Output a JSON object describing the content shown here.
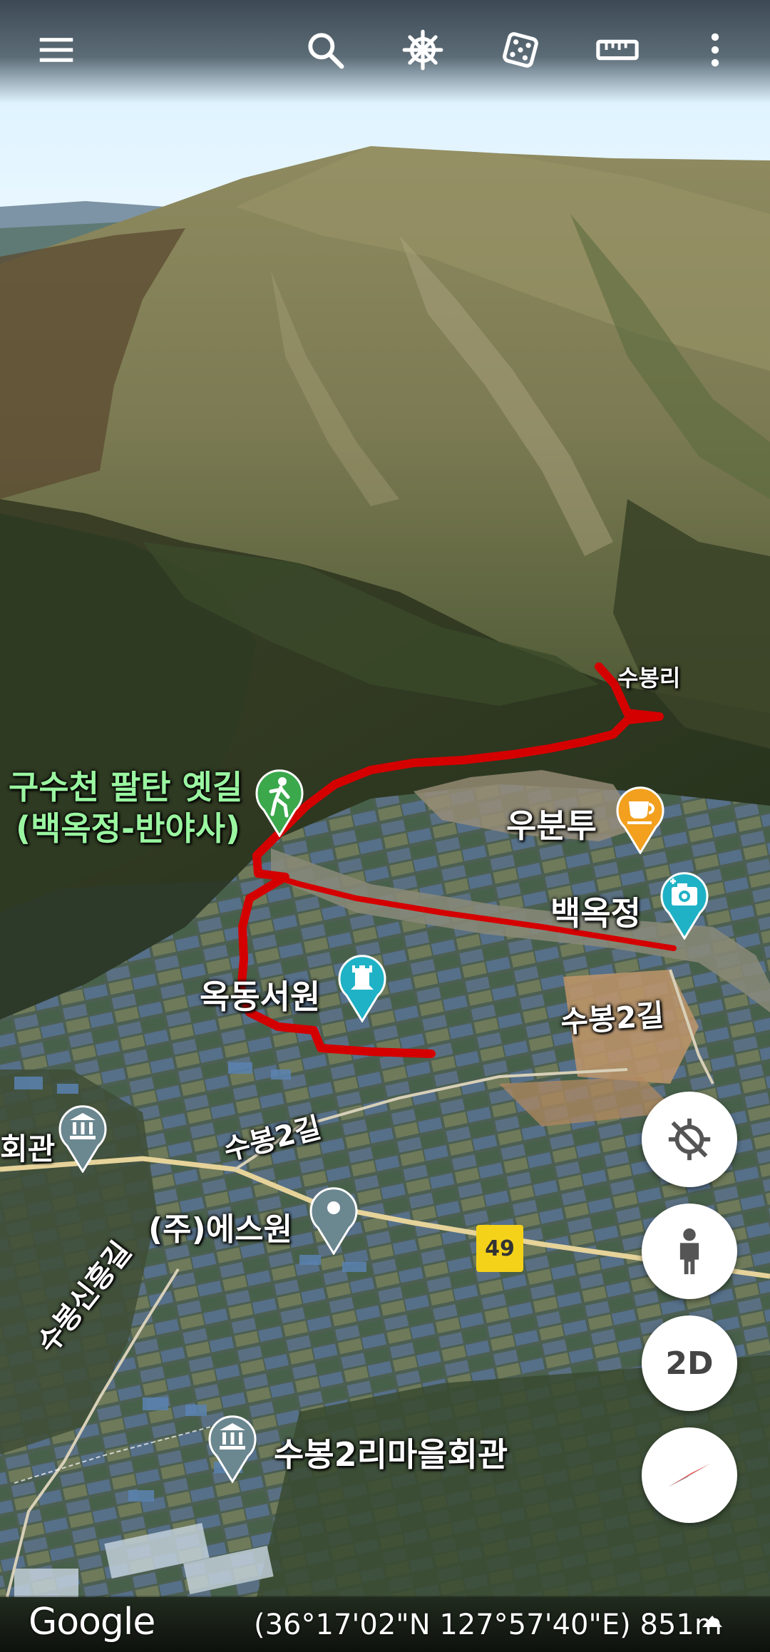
{
  "toolbar": {
    "menu_icon": "menu-icon",
    "search_icon": "search-icon",
    "voyager_icon": "ship-wheel-icon",
    "feeling_lucky_icon": "dice-icon",
    "measure_icon": "ruler-icon",
    "more_icon": "more-vertical-icon"
  },
  "map_labels": {
    "trail_line1": "구수천 팔탄 옛길",
    "trail_line2": "(백옥정-반야사)",
    "village_subong": "수봉리",
    "ubuntu": "우분투",
    "baekokjeong": "백옥정",
    "okdong_seowon": "옥동서원",
    "subong_2gil_right": "수봉2길",
    "subong_2gil_left": "수봉2길",
    "hall_partial": "회관",
    "company": "(주)에스원",
    "road_number": "49",
    "road_subong_sinheung": "수봉신흥길",
    "subong2ri_hall": "수봉2리마을회관"
  },
  "fabs": {
    "location_icon": "location-off-icon",
    "pegman_icon": "pegman-icon",
    "view_mode": "2D",
    "compass_icon": "compass-icon"
  },
  "footer": {
    "logo": "Google",
    "coordinates": "(36°17'02\"N 127°57'40\"E) 851m",
    "expand_icon": "caret-up-icon"
  },
  "colors": {
    "route": "#d40000",
    "hiking_pin": "#3aa84b",
    "cafe_pin": "#f2a01e",
    "landmark_pin": "#1fb2c6",
    "institution_pin": "#6b8790",
    "generic_pin": "#6b8790",
    "road_badge": "#f5d21a"
  }
}
